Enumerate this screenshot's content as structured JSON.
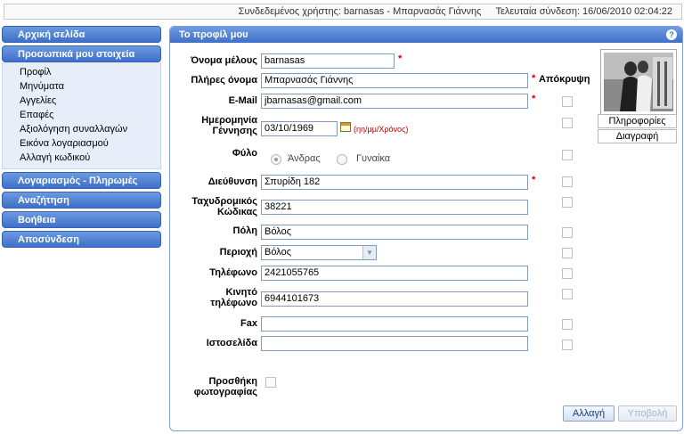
{
  "topbar": {
    "logged_user": "Συνδεδεμένος χρήστης: barnasas - Μπαρνασάς Γιάννης",
    "last_login": "Τελευταία σύνδεση: 16/06/2010 02:04:22"
  },
  "sidebar": {
    "home": "Αρχική σελίδα",
    "personal": "Προσωπικά μου στοιχεία",
    "personal_items": [
      "Προφίλ",
      "Μηνύματα",
      "Αγγελίες",
      "Επαφές",
      "Αξιολόγηση συναλλαγών",
      "Εικόνα λογαριασμού",
      "Αλλαγή κωδικού"
    ],
    "account": "Λογαριασμός - Πληρωμές",
    "search": "Αναζήτηση",
    "help": "Βοήθεια",
    "logout": "Αποσύνδεση"
  },
  "panel": {
    "title": "Το προφίλ μου",
    "help_icon": "?",
    "hide_label": "Απόκρυψη",
    "fields": {
      "username": {
        "label": "Όνομα μέλους",
        "value": "barnasas"
      },
      "fullname": {
        "label": "Πλήρες όνομα",
        "value": "Μπαρνασάς Γιάννης"
      },
      "email": {
        "label": "E-Mail",
        "value": "jbarnasas@gmail.com"
      },
      "birthdate": {
        "label1": "Ημερομηνία",
        "label2": "Γέννησης",
        "value": "03/10/1969",
        "hint": "(ηη/μμ/Χρόνος)"
      },
      "gender": {
        "label": "Φύλο",
        "male": "Άνδρας",
        "female": "Γυναίκα",
        "selected": "male"
      },
      "address": {
        "label": "Διεύθυνση",
        "value": "Σπυρίδη 182"
      },
      "postal": {
        "label1": "Ταχυδρομικός",
        "label2": "Κώδικας",
        "value": "38221"
      },
      "city": {
        "label": "Πόλη",
        "value": "Βόλος"
      },
      "region": {
        "label": "Περιοχή",
        "value": "Βόλος"
      },
      "phone": {
        "label": "Τηλέφωνο",
        "value": "2421055765"
      },
      "mobile": {
        "label1": "Κινητό",
        "label2": "τηλέφωνο",
        "value": "6944101673"
      },
      "fax": {
        "label": "Fax",
        "value": ""
      },
      "website": {
        "label": "Ιστοσελίδα",
        "value": ""
      },
      "add_photo": {
        "label1": "Προσθήκη",
        "label2": "φωτογραφίας"
      }
    },
    "photo_info": "Πληροφορίες",
    "photo_delete": "Διαγραφή",
    "change_button": "Αλλαγή",
    "submit_button": "Υποβολή"
  }
}
